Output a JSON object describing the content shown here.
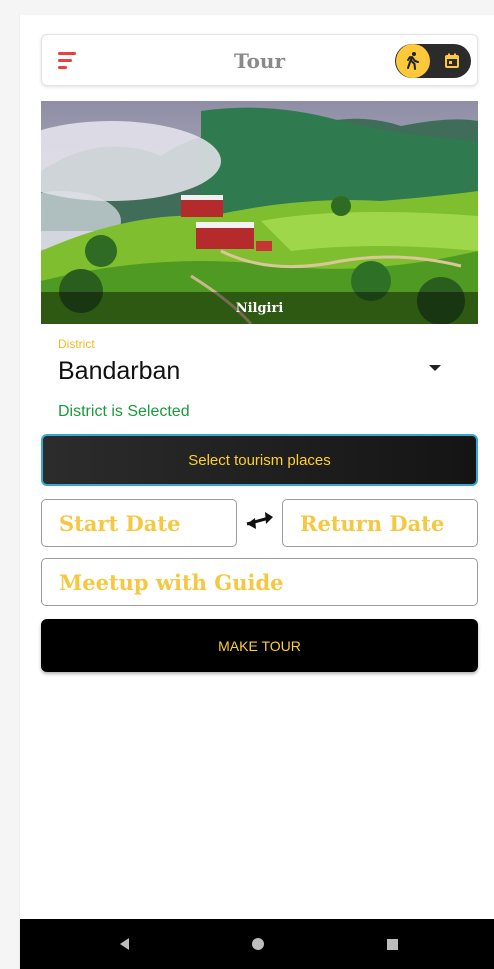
{
  "appbar": {
    "title": "Tour",
    "menu_icon": "menu-icon",
    "toggle_icons": [
      "hiking-icon",
      "calendar-icon"
    ],
    "accent_color": "#ee3d3d",
    "toggle_color": "#fdc93a"
  },
  "banner": {
    "caption": "Nilgiri"
  },
  "district": {
    "label": "District",
    "value": "Bandarban",
    "helper": "District is Selected",
    "helper_color": "#1a9a3a"
  },
  "actions": {
    "select_places_label": "Select tourism places",
    "make_tour_label": "MAKE TOUR"
  },
  "fields": {
    "start_date_placeholder": "Start Date",
    "return_date_placeholder": "Return Date",
    "guide_placeholder": "Meetup with Guide"
  },
  "navbar": {
    "icons": [
      "back-icon",
      "home-icon",
      "recents-icon"
    ]
  }
}
